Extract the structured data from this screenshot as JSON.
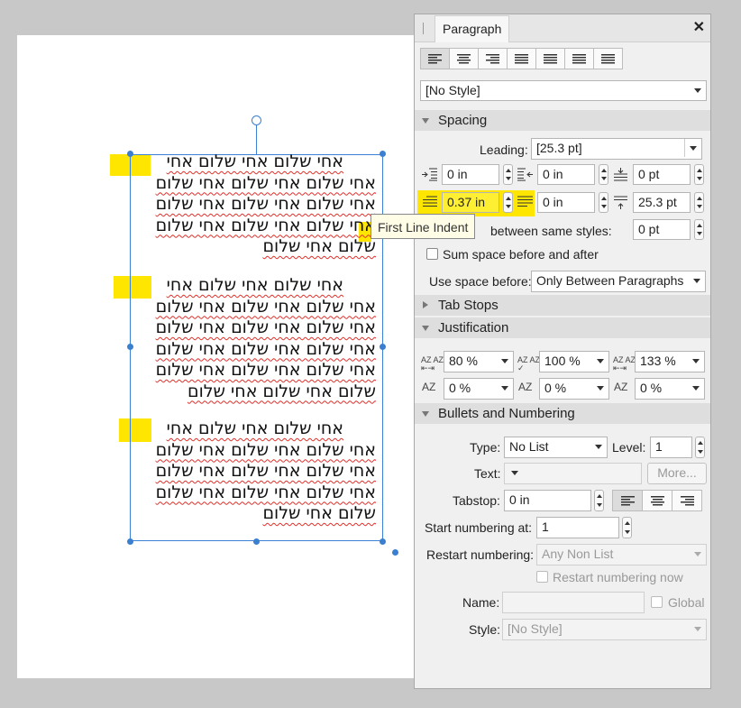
{
  "document": {
    "paragraphs": [
      [
        "אחי שלום אחי שלום אחי",
        "אחי שלום אחי שלום אחי שלום",
        "אחי שלום אחי שלום אחי שלום",
        "אחי שלום אחי שלום אחי שלום",
        "שלום אחי שלום"
      ],
      [
        "אחי שלום אחי שלום אחי",
        "אחי שלום אחי שלום אחי שלום",
        "אחי שלום אחי שלום אחי שלום",
        "אחי שלום אחי שלום אחי שלום",
        "אחי שלום אחי שלום אחי שלום",
        "שלום אחי שלום אחי שלום"
      ],
      [
        "אחי שלום אחי שלום אחי",
        "אחי שלום אחי שלום אחי שלום",
        "אחי שלום אחי שלום אחי שלום",
        "אחי שלום אחי שלום אחי שלום",
        "שלום אחי שלום"
      ]
    ]
  },
  "tooltip": "First Line Indent",
  "panel": {
    "title": "Paragraph",
    "close": "✕",
    "style_select": "[No Style]",
    "spacing": {
      "header": "Spacing",
      "leading_label": "Leading:",
      "leading_value": "[25.3 pt]",
      "left_indent": "0 in",
      "right_indent": "0 in",
      "space_before": "0 pt",
      "first_line_indent": "0.37 in",
      "last_line_indent": "0 in",
      "space_after": "25.3 pt",
      "between_label": "between same styles:",
      "between_value": "0 pt",
      "sum_label": "Sum space before and after",
      "use_space_label": "Use space before:",
      "use_space_value": "Only Between Paragraphs"
    },
    "tab_stops": "Tab Stops",
    "justification": {
      "header": "Justification",
      "word_min": "80 %",
      "word_desired": "100 %",
      "word_max": "133 %",
      "letter_min": "0 %",
      "letter_desired": "0 %",
      "letter_max": "0 %"
    },
    "bullets": {
      "header": "Bullets and Numbering",
      "type_label": "Type:",
      "type_value": "No List",
      "level_label": "Level:",
      "level_value": "1",
      "text_label": "Text:",
      "more_label": "More...",
      "tabstop_label": "Tabstop:",
      "tabstop_value": "0 in",
      "start_label": "Start numbering at:",
      "start_value": "1",
      "restart_label": "Restart numbering:",
      "restart_value": "Any Non List",
      "restart_now_label": "Restart numbering now",
      "name_label": "Name:",
      "global_label": "Global",
      "style_label": "Style:",
      "style_value": "[No Style]"
    }
  },
  "colors": {
    "highlight": "#ffe600",
    "selection": "#3b82d6",
    "spell_underline": "#e0302b"
  }
}
